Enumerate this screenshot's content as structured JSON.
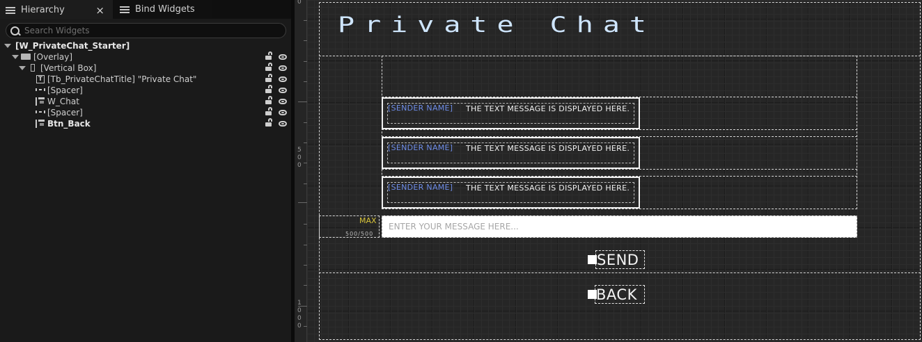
{
  "tabs": {
    "hierarchy": "Hierarchy",
    "close": "×",
    "bind_widgets": "Bind Widgets"
  },
  "search": {
    "placeholder": "Search Widgets"
  },
  "tree": [
    {
      "label": "[W_PrivateChat_Starter]",
      "icon": "none",
      "expanded": true
    },
    {
      "label": "[Overlay]",
      "icon": "overlay-icon",
      "expanded": true
    },
    {
      "label": "[Vertical Box]",
      "icon": "vertical-box-icon",
      "expanded": true
    },
    {
      "label": "[Tb_PrivateChatTitle] \"Private Chat\"",
      "icon": "text-block-icon"
    },
    {
      "label": "[Spacer]",
      "icon": "spacer-icon"
    },
    {
      "label": "W_Chat",
      "icon": "user-widget-icon"
    },
    {
      "label": "[Spacer]",
      "icon": "spacer-icon"
    },
    {
      "label": "Btn_Back",
      "icon": "user-widget-icon"
    }
  ],
  "ruler": {
    "mark_0": "0",
    "mark_500": "500",
    "mark_1000": "1000"
  },
  "canvas": {
    "title": "Private Chat",
    "messages": [
      {
        "sender": "[SENDER NAME]",
        "text": "THE TEXT MESSAGE IS DISPLAYED HERE."
      },
      {
        "sender": "[SENDER NAME]",
        "text": "THE TEXT MESSAGE IS DISPLAYED HERE."
      },
      {
        "sender": "[SENDER NAME]",
        "text": "THE TEXT MESSAGE IS DISPLAYED HERE."
      }
    ],
    "max_label": "MAX",
    "count_label": "500/500",
    "input_placeholder": "ENTER YOUR MESSAGE HERE...",
    "send_label": "SEND",
    "back_label": "BACK"
  },
  "colors": {
    "title": "#cfe6ff",
    "sender": "#6e8de8",
    "max": "#d8c43a"
  }
}
